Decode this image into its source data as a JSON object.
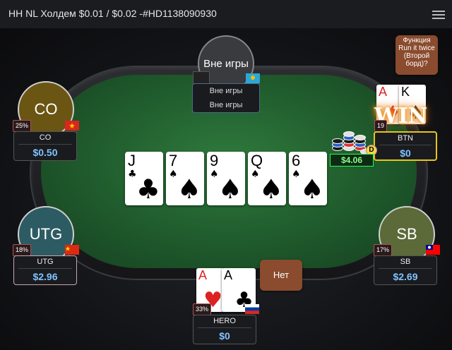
{
  "window": {
    "title": "HH NL Холдем $0.01 / $0.02 -#HD1138090930"
  },
  "sitout_seat": {
    "avatar_text": "Вне игры",
    "line1": "Вне игры",
    "line2": "Вне игры"
  },
  "run_it_twice_bubble": "Функция Run it twice (Второй борд)?",
  "board": [
    {
      "rank": "J",
      "suit": "♣",
      "color": "black"
    },
    {
      "rank": "7",
      "suit": "♠",
      "color": "black"
    },
    {
      "rank": "9",
      "suit": "♠",
      "color": "black"
    },
    {
      "rank": "Q",
      "suit": "♠",
      "color": "black"
    },
    {
      "rank": "6",
      "suit": "♠",
      "color": "black"
    }
  ],
  "pot": "$4.06",
  "win_label": "WIN",
  "seats": {
    "co": {
      "avatar": "CO",
      "name": "CO",
      "stack": "$0.50",
      "vpip": "25%",
      "avatar_color": "#6b5513",
      "flag": "vietnam"
    },
    "utg": {
      "avatar": "UTG",
      "name": "UTG",
      "stack": "$2.96",
      "vpip": "18%",
      "avatar_color": "#2d5b63",
      "flag": "china"
    },
    "btn": {
      "name": "BTN",
      "stack": "$0",
      "vpip": "19",
      "cards": [
        {
          "rank": "A",
          "suit": "♦",
          "color": "red"
        },
        {
          "rank": "K",
          "suit": "♠",
          "color": "black"
        }
      ],
      "dealer": "D"
    },
    "sb": {
      "avatar": "SB",
      "name": "SB",
      "stack": "$2.69",
      "vpip": "17%",
      "avatar_color": "#5b6a38",
      "flag": "taiwan"
    },
    "hero": {
      "name": "HERO",
      "stack": "$0",
      "vpip": "33%",
      "flag": "russia",
      "cards": [
        {
          "rank": "A",
          "suit": "♥",
          "color": "red"
        },
        {
          "rank": "A",
          "suit": "♣",
          "color": "black"
        }
      ]
    }
  },
  "hero_bubble": "Нет",
  "colors": {
    "felt": "#2f7a3d",
    "stack_text": "#7fc3ff",
    "win_glow": "#f6a623",
    "btn_border": "#e6c619"
  }
}
